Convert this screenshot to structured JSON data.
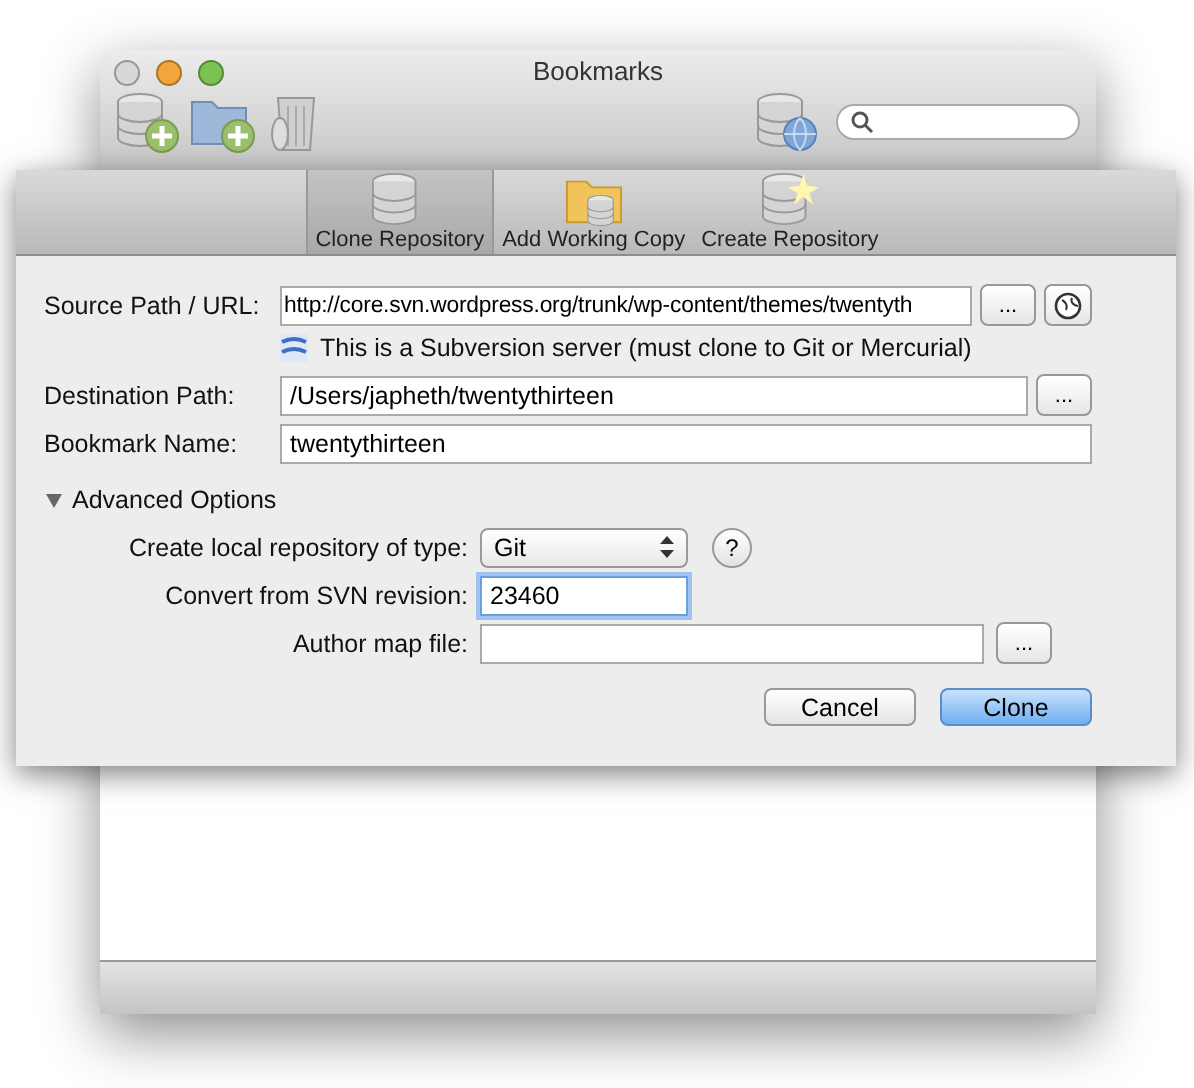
{
  "window": {
    "title": "Bookmarks"
  },
  "tabs": [
    {
      "label": "Clone Repository",
      "selected": true
    },
    {
      "label": "Add Working Copy",
      "selected": false
    },
    {
      "label": "Create Repository",
      "selected": false
    }
  ],
  "source": {
    "label": "Source Path / URL:",
    "value": "http://core.svn.wordpress.org/trunk/wp-content/themes/twentyth",
    "browse": "...",
    "note": "This is a Subversion server (must clone to Git or Mercurial)"
  },
  "destination": {
    "label": "Destination Path:",
    "value": "/Users/japheth/twentythirteen",
    "browse": "..."
  },
  "bookmark": {
    "label": "Bookmark Name:",
    "value": "twentythirteen"
  },
  "advanced": {
    "label": "Advanced Options",
    "expanded": true,
    "repo_type": {
      "label": "Create local repository of type:",
      "value": "Git",
      "help": "?"
    },
    "revision": {
      "label": "Convert from SVN revision:",
      "value": "23460"
    },
    "author_map": {
      "label": "Author map file:",
      "browse": "..."
    }
  },
  "buttons": [
    {
      "label": "Cancel",
      "default": false
    },
    {
      "label": "Clone",
      "default": true
    }
  ]
}
